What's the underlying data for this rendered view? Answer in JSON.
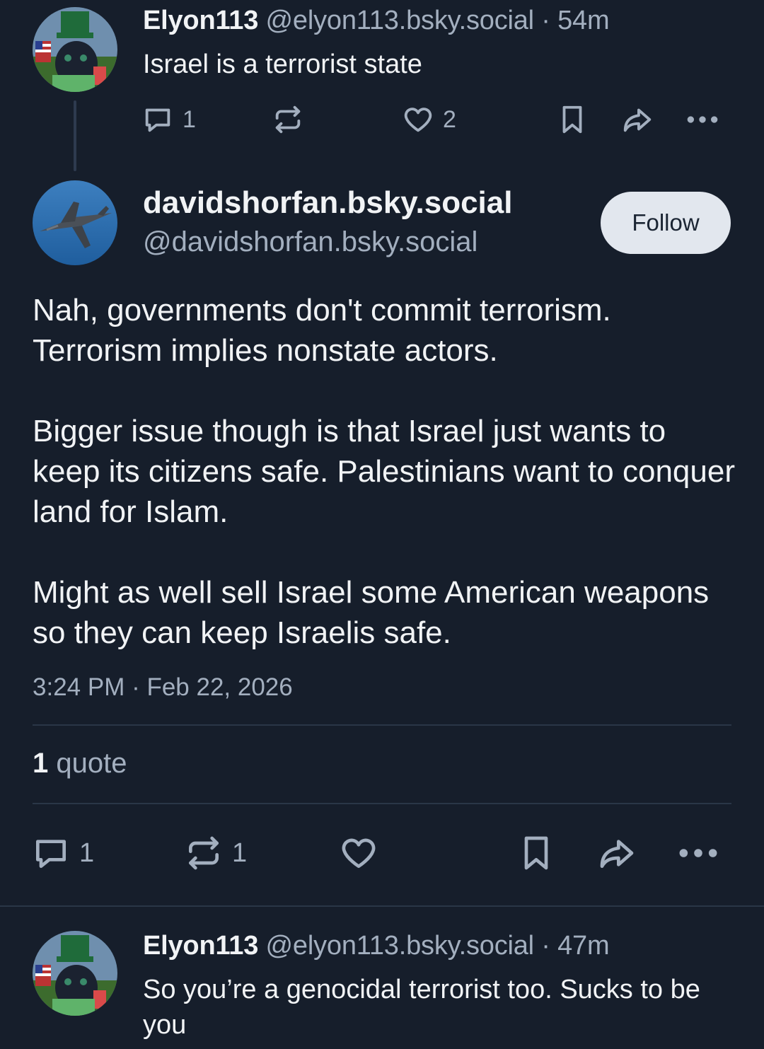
{
  "parent_post": {
    "display_name": "Elyon113",
    "handle": "@elyon113.bsky.social",
    "separator": "·",
    "time": "54m",
    "text": "Israel is a terrorist state",
    "reply_count": "1",
    "like_count": "2"
  },
  "main_post": {
    "display_name": "davidshorfan.bsky.social",
    "handle": "@davidshorfan.bsky.social",
    "follow_label": "Follow",
    "paragraphs": [
      "Nah, governments don't commit terrorism. Terrorism implies nonstate actors.",
      "Bigger issue though is that Israel just wants to keep its citizens safe. Palestinians want to conquer land for Islam.",
      "Might as well sell Israel some American weapons so they can keep Israelis safe."
    ],
    "timestamp": "3:24 PM · Feb 22, 2026",
    "quote_count": "1",
    "quote_label": "quote",
    "reply_count": "1",
    "repost_count": "1"
  },
  "reply_post": {
    "display_name": "Elyon113",
    "handle": "@elyon113.bsky.social",
    "separator": "·",
    "time": "47m",
    "text": "So you’re a genocidal terrorist too. Sucks to be you"
  },
  "icons": [
    "reply-icon",
    "repost-icon",
    "like-icon",
    "bookmark-icon",
    "share-icon",
    "more-icon"
  ],
  "colors": {
    "background": "#161e2b",
    "text": "#f1f3f5",
    "muted": "#a3afbf",
    "follow_button": "#e2e7ee",
    "divider": "#2a3647"
  }
}
